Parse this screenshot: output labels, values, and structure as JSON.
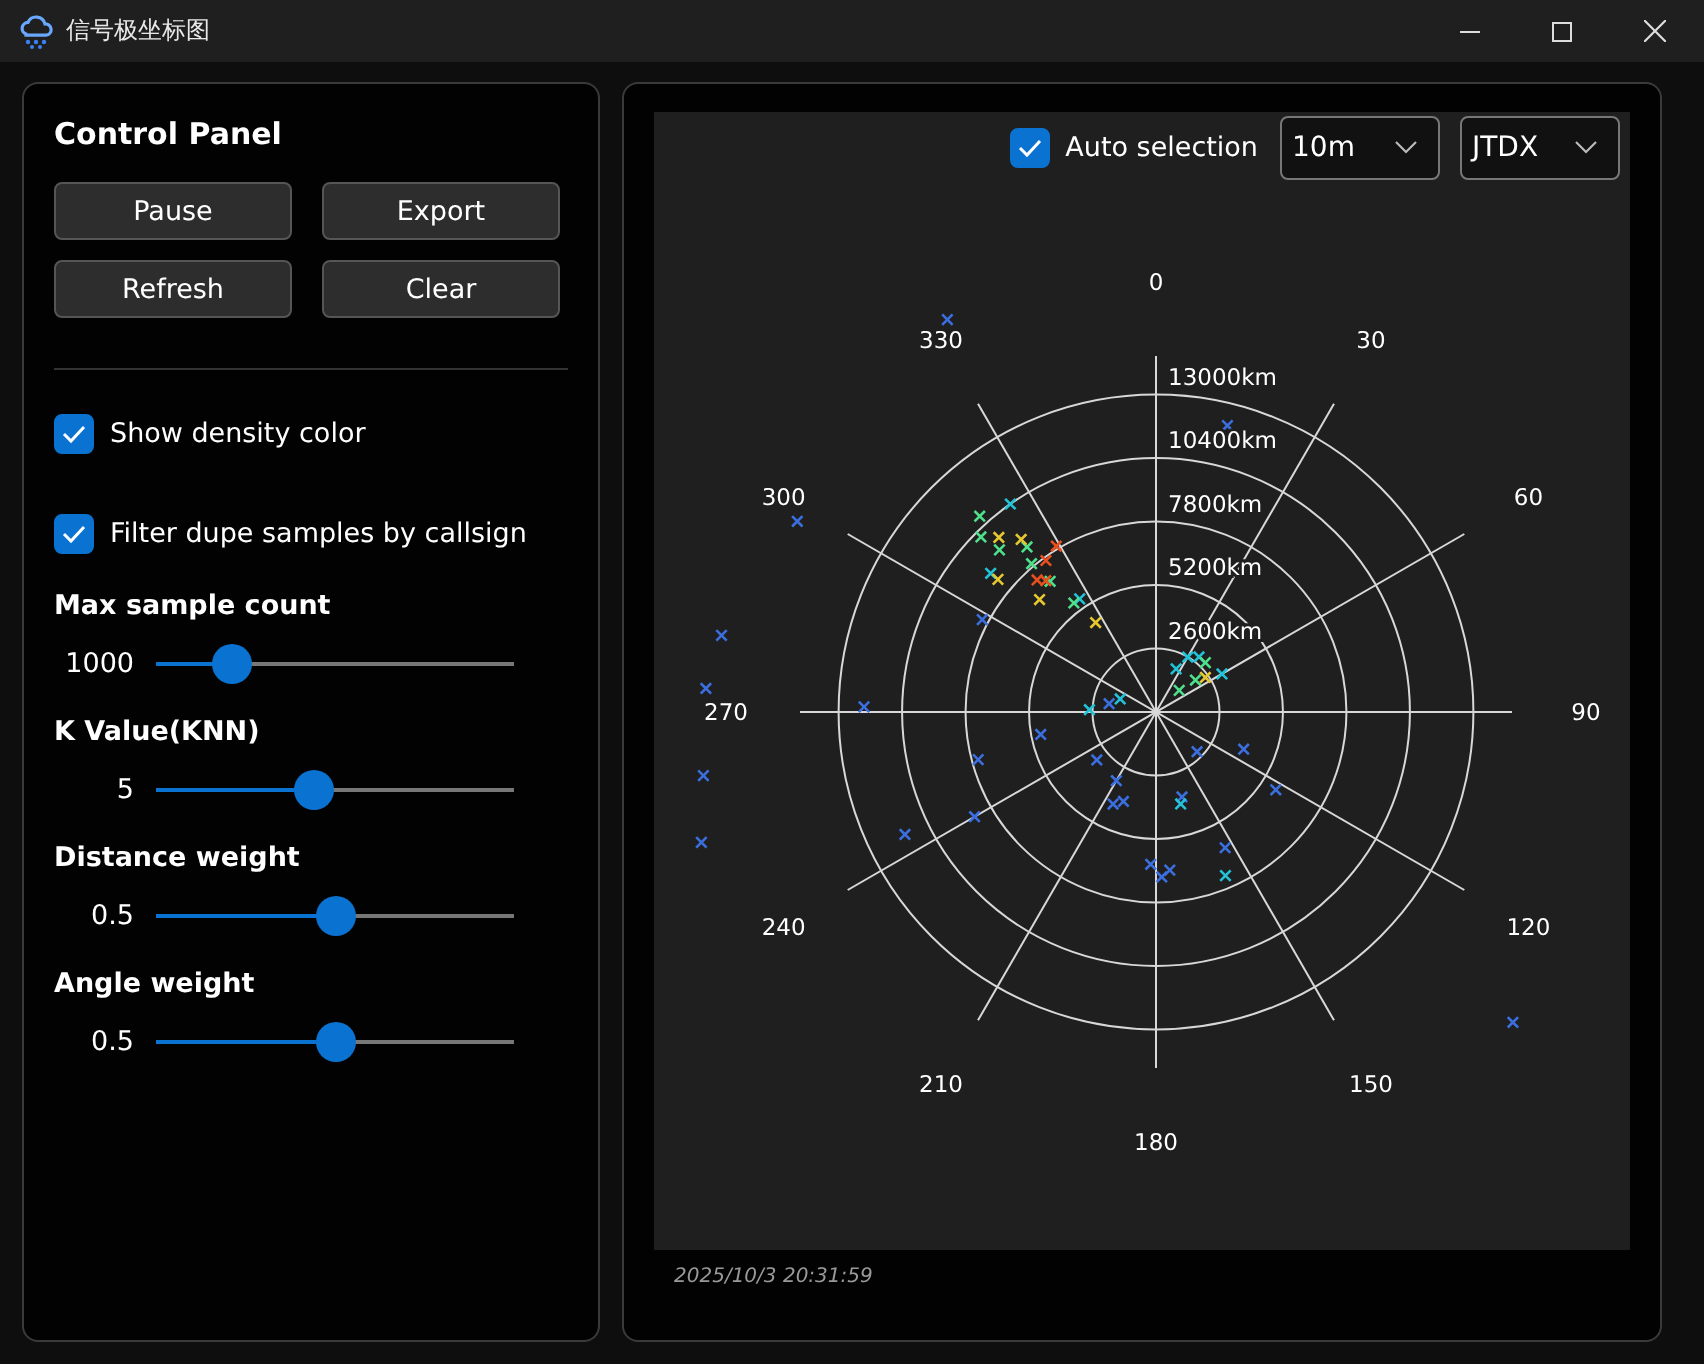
{
  "window": {
    "title": "信号极坐标图"
  },
  "control_panel": {
    "title": "Control Panel",
    "buttons": [
      "Pause",
      "Export",
      "Refresh",
      "Clear"
    ],
    "checkboxes": [
      {
        "label": "Show density color",
        "checked": true
      },
      {
        "label": "Filter dupe samples by callsign",
        "checked": true
      }
    ],
    "sliders": [
      {
        "label": "Max sample count",
        "reading": "1000",
        "level": 0.21
      },
      {
        "label": "K Value(KNN)",
        "reading": "5",
        "level": 0.44
      },
      {
        "label": "Distance weight",
        "reading": "0.5",
        "level": 0.5
      },
      {
        "label": "Angle weight",
        "reading": "0.5",
        "level": 0.5
      }
    ]
  },
  "chart_panel": {
    "auto_selection": {
      "label": "Auto selection",
      "checked": true
    },
    "dropdowns": [
      {
        "value": "10m"
      },
      {
        "value": "JTDX"
      }
    ],
    "polar_plot": {
      "angle_labels": [
        "0",
        "30",
        "60",
        "90",
        "120",
        "150",
        "180",
        "210",
        "240",
        "270",
        "300",
        "330"
      ],
      "ring_labels": [
        "13000km",
        "10400km",
        "7800km",
        "5200km",
        "2600km"
      ]
    },
    "timestamp": "2025/10/3 20:31:59"
  }
}
